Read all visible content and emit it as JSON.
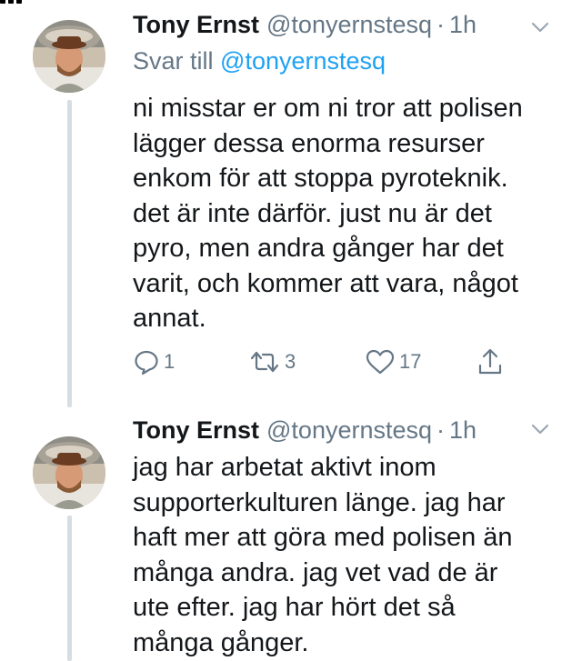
{
  "tweets": [
    {
      "author_name": "Tony Ernst",
      "handle": "@tonyernstesq",
      "separator": "·",
      "time": "1h",
      "reply_prefix": "Svar till",
      "reply_mention": "@tonyernstesq",
      "lines": [
        "ni misstar er om ni tror att polisen",
        "lägger dessa enorma resurser",
        "enkom för att stoppa pyroteknik.",
        "det är inte därför. just nu är det",
        "pyro, men andra gånger har det",
        "varit, och kommer att vara, något",
        "annat."
      ],
      "actions": {
        "reply_count": "1",
        "retweet_count": "3",
        "like_count": "17"
      }
    },
    {
      "author_name": "Tony Ernst",
      "handle": "@tonyernstesq",
      "separator": "·",
      "time": "1h",
      "lines": [
        "jag har arbetat aktivt inom",
        "supporterkulturen länge. jag har",
        "haft mer att göra med polisen än",
        "många andra. jag vet vad de är",
        "ute efter. jag har hört det så",
        "många gånger."
      ]
    }
  ],
  "colors": {
    "text": "#14171a",
    "secondary": "#657786",
    "link": "#1da1f2",
    "thread_line": "#d6dde3"
  },
  "icons": [
    "reply-icon",
    "retweet-icon",
    "like-icon",
    "share-icon",
    "chevron-down-icon"
  ]
}
